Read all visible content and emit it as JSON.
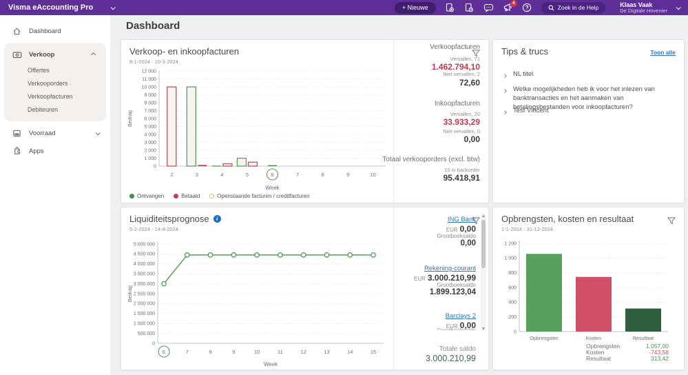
{
  "topbar": {
    "app_title": "Visma eAccounting Pro",
    "new_button": "+ Nieuwe",
    "search_label": "Zoek in de Help",
    "notification_count": "4",
    "user": {
      "name": "Klaas Vaak",
      "company": "De Digitale Hovenier"
    }
  },
  "sidebar": {
    "items": [
      {
        "label": "Dashboard"
      },
      {
        "label": "Verkoop",
        "children": [
          "Offertes",
          "Verkooporders",
          "Verkoopfacturen",
          "Debiteuren"
        ]
      },
      {
        "label": "Voorraad"
      },
      {
        "label": "Apps"
      }
    ]
  },
  "page_title": "Dashboard",
  "colors": {
    "topbar": "#5e2f96",
    "green": "#57a05c",
    "dark_green": "#2e5f3e",
    "red": "#cc3d54",
    "pink_red": "#d05068",
    "legend_yellow": "#d9c34b",
    "link_blue": "#2a76bf",
    "value_red": "#c03a4e"
  },
  "cards": {
    "sales": {
      "title": "Verkoop- en inkoopfacturen",
      "date_range": "8-1-2024 - 10-3-2024",
      "stats_groups": [
        {
          "header": "Verkoopfacturen",
          "rows": [
            {
              "label": "Vervallen, 71",
              "value": "1.462.794,10",
              "tone": "red"
            },
            {
              "label": "Niet vervallen, 2",
              "value": "72,60",
              "tone": "dark"
            }
          ]
        },
        {
          "header": "Inkoopfacturen",
          "rows": [
            {
              "label": "Vervallen, 20",
              "value": "33.933,29",
              "tone": "red"
            },
            {
              "label": "Niet vervallen, 0",
              "value": "0,00",
              "tone": "dark"
            }
          ]
        },
        {
          "header": "Totaal verkooporders (excl. btw)",
          "rows": [
            {
              "label": "15 in backorder",
              "value": "95.418,91",
              "tone": "dark"
            }
          ]
        }
      ]
    },
    "tips": {
      "title": "Tips & trucs",
      "link": "Toon alle",
      "items": [
        "NL titel",
        "Welke mogelijkheden heb ik voor het inlezen van banktransacties en het aanmaken van betalingsbestanden voor inkoopfacturen?",
        "Test Vincent"
      ]
    },
    "liquidity": {
      "title": "Liquiditeitsprognose",
      "date_range": "5-2-2024 - 14-4-2024",
      "labels": {
        "eur": "EUR",
        "grootboek": "Grootboeksaldo"
      },
      "banks": [
        {
          "name": "ING Bank",
          "eur": "0,00",
          "grootboeksaldo": "0,00"
        },
        {
          "name": "Rekening-courant",
          "eur": "3.000.210,99",
          "grootboeksaldo": "1.899.123,04"
        },
        {
          "name": "Barclays 2",
          "eur": "0,00",
          "grootboeksaldo": ""
        }
      ],
      "total_label": "Totale saldo",
      "total_value": "3.000.210,99"
    },
    "result": {
      "title": "Opbrengsten, kosten en resultaat",
      "date_range": "1-1-2024 - 31-12-2024",
      "summary": [
        {
          "label": "Opbrengsten",
          "value": "1.057,00",
          "tone": "green"
        },
        {
          "label": "Kosten",
          "value": "-743,58",
          "tone": "red"
        },
        {
          "label": "Resultaat",
          "value": "313,42",
          "tone": "green"
        }
      ]
    }
  },
  "chart_data": [
    {
      "id": "sales",
      "type": "bar",
      "title": "Verkoop- en inkoopfacturen",
      "xlabel": "Week",
      "ylabel": "Bedrag",
      "ylim": [
        0,
        12000
      ],
      "ytick_step": 1000,
      "ytick_labels": [
        "0",
        "1 000",
        "2 000",
        "3 000",
        "4 000",
        "5 000",
        "6 000",
        "7 000",
        "8 000",
        "9 000",
        "10 000",
        "11 000",
        "12 000"
      ],
      "categories": [
        "2",
        "3",
        "4",
        "5",
        "6",
        "7",
        "8",
        "9",
        "10"
      ],
      "highlighted_category": "6",
      "grid": "dotted",
      "bars": [
        {
          "week": "2",
          "value": 10000,
          "series": "Betaald",
          "style": "outline",
          "color": "#cc4d5e"
        },
        {
          "week": "3",
          "value": 10000,
          "series": "Ontvangen",
          "style": "outline",
          "color": "#57a05c"
        },
        {
          "week": "3",
          "value": 150,
          "series": "Betaald",
          "style": "solid",
          "color": "#cc3d54"
        },
        {
          "week": "4",
          "value": 60,
          "series": "Ontvangen",
          "style": "solid",
          "color": "#3f9142"
        },
        {
          "week": "4",
          "value": 300,
          "series": "Betaald",
          "style": "outline",
          "color": "#cc4d5e"
        },
        {
          "week": "5",
          "value": 1000,
          "series": "Ontvangen",
          "style": "outline",
          "color": "#57a05c"
        },
        {
          "week": "5",
          "value": 500,
          "series": "Betaald",
          "style": "outline",
          "color": "#cc4d5e"
        },
        {
          "week": "6",
          "value": 120,
          "series": "Ontvangen",
          "style": "solid",
          "color": "#3f9142"
        }
      ],
      "legend": [
        {
          "label": "Ontvangen",
          "color": "#3f9142",
          "style": "solid"
        },
        {
          "label": "Betaald",
          "color": "#cc3d54",
          "style": "solid"
        },
        {
          "label": "Openstaande facturen / creditfacturen",
          "color": "#d9c34b",
          "style": "outline"
        }
      ],
      "legend_position": "bottom"
    },
    {
      "id": "liquidity",
      "type": "line",
      "title": "Liquiditeitsprognose",
      "xlabel": "Week",
      "ylabel": "Bedrag",
      "ylim": [
        0,
        5000000
      ],
      "ytick_step": 500000,
      "ytick_labels": [
        "0",
        "500 000",
        "1 000 000",
        "1 500 000",
        "2 000 000",
        "2 500 000",
        "3 000 000",
        "3 500 000",
        "4 000 000",
        "4 500 000",
        "5 000 000"
      ],
      "x": [
        "6",
        "7",
        "8",
        "9",
        "10",
        "11",
        "12",
        "13",
        "14",
        "15"
      ],
      "highlighted_category": "6",
      "grid": "dotted",
      "values": [
        3000000,
        4450000,
        4450000,
        4450000,
        4450000,
        4450000,
        4450000,
        4450000,
        4450000,
        4450000
      ],
      "color": "#57a05c"
    },
    {
      "id": "result",
      "type": "bar",
      "title": "Opbrengsten, kosten en resultaat",
      "ylim": [
        0,
        1200
      ],
      "ytick_step": 200,
      "ytick_labels": [
        "0",
        "200",
        "400",
        "600",
        "800",
        "1 000",
        "1 200"
      ],
      "categories": [
        "Opbrengsten",
        "Kosten",
        "Resultaat"
      ],
      "values": [
        1057,
        743.58,
        313.42
      ],
      "colors": [
        "#57a05c",
        "#d05068",
        "#2e5f3e"
      ],
      "grid": "dotted"
    }
  ]
}
